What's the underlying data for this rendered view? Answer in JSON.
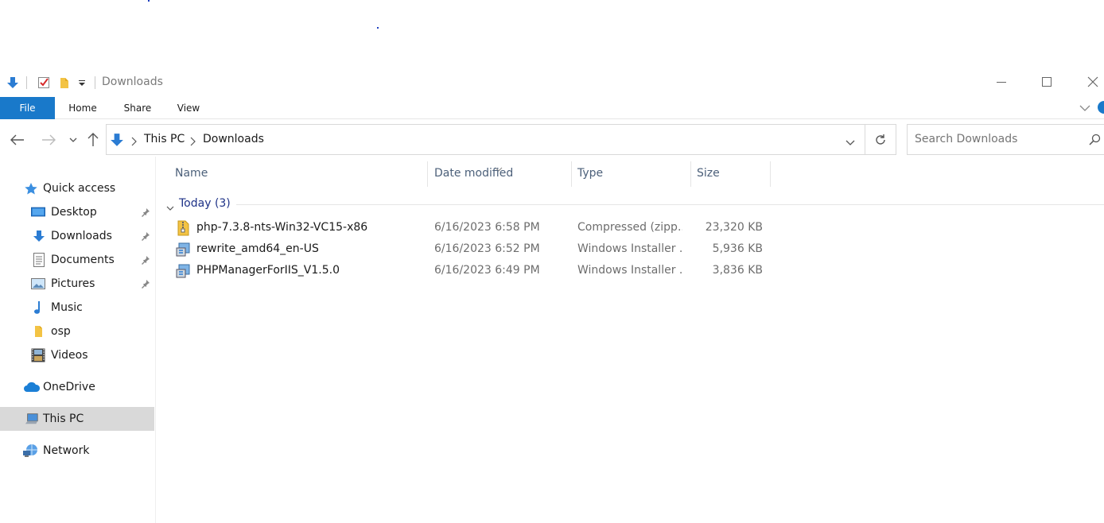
{
  "window": {
    "title": "Downloads",
    "minimize": "—",
    "maximize": "☐",
    "close": "✕"
  },
  "ribbon": {
    "tabs": [
      "File",
      "Home",
      "Share",
      "View"
    ]
  },
  "address": {
    "crumbs": [
      "This PC",
      "Downloads"
    ],
    "search_placeholder": "Search Downloads"
  },
  "sidebar": {
    "items": [
      {
        "label": "Quick access",
        "icon": "star-icon"
      },
      {
        "label": "Desktop",
        "icon": "desktop-icon",
        "pinned": true
      },
      {
        "label": "Downloads",
        "icon": "download-arrow-icon",
        "pinned": true
      },
      {
        "label": "Documents",
        "icon": "documents-icon",
        "pinned": true
      },
      {
        "label": "Pictures",
        "icon": "pictures-icon",
        "pinned": true
      },
      {
        "label": "Music",
        "icon": "music-note-icon"
      },
      {
        "label": "osp",
        "icon": "folder-icon"
      },
      {
        "label": "Videos",
        "icon": "film-icon"
      },
      {
        "label": "OneDrive",
        "icon": "cloud-icon"
      },
      {
        "label": "This PC",
        "icon": "computer-icon",
        "selected": true
      },
      {
        "label": "Network",
        "icon": "network-icon"
      }
    ]
  },
  "columns": {
    "name": "Name",
    "date": "Date modified",
    "type": "Type",
    "size": "Size"
  },
  "group": {
    "label": "Today (3)"
  },
  "files": [
    {
      "name": "php-7.3.8-nts-Win32-VC15-x86",
      "date": "6/16/2023 6:58 PM",
      "type": "Compressed (zipp...",
      "size": "23,320 KB",
      "icon": "zip-folder-icon"
    },
    {
      "name": "rewrite_amd64_en-US",
      "date": "6/16/2023 6:52 PM",
      "type": "Windows Installer ...",
      "size": "5,936 KB",
      "icon": "installer-icon"
    },
    {
      "name": "PHPManagerForIIS_V1.5.0",
      "date": "6/16/2023 6:49 PM",
      "type": "Windows Installer ...",
      "size": "3,836 KB",
      "icon": "installer-icon"
    }
  ],
  "colors": {
    "accent": "#1979ca",
    "group_header": "#1e3287",
    "column_header": "#4c607a",
    "selected_bg": "#d9d9d9"
  }
}
